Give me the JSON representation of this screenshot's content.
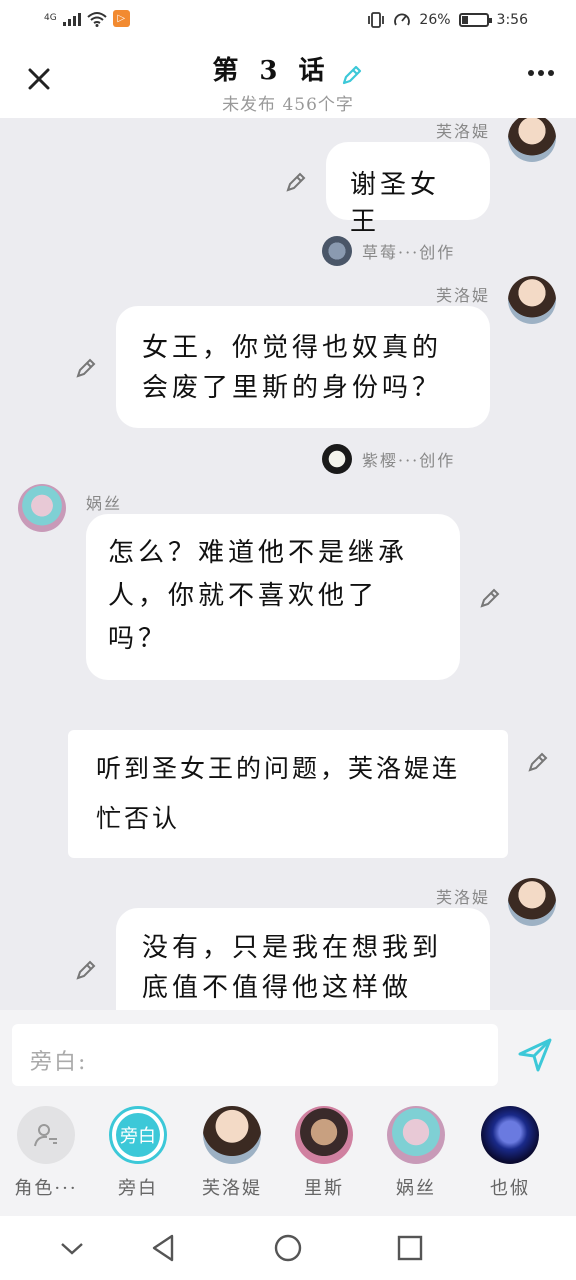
{
  "status_bar": {
    "network": "4G",
    "battery": "26%",
    "battery_level": 0.26,
    "time": "3:56",
    "app_badge_glyph": "▷"
  },
  "header": {
    "title": "第 3 话",
    "subtitle": "未发布  456个字"
  },
  "messages": [
    {
      "speaker": "芙洛媞",
      "text": "谢圣女王"
    },
    {
      "creator": "草莓···创作",
      "speaker": "芙洛媞",
      "line1": "女王，你觉得也奴真的",
      "line2": "会废了里斯的身份吗？"
    },
    {
      "creator": "紫樱···创作",
      "speaker": "娲丝",
      "line1": "怎么？难道他不是继承",
      "line2": "人，你就不喜欢他了",
      "line3": "吗？"
    },
    {
      "type": "narration",
      "line1": "听到圣女王的问题，芙洛媞连",
      "line2": "忙否认"
    },
    {
      "speaker": "芙洛媞",
      "line1": "没有，只是我在想我到",
      "line2": "底值不值得他这样做"
    }
  ],
  "input": {
    "placeholder": "旁白:"
  },
  "roles": [
    {
      "label": "角色···",
      "icon": "add-role-icon"
    },
    {
      "label": "旁白",
      "badge": "旁白"
    },
    {
      "label": "芙洛媞"
    },
    {
      "label": "里斯"
    },
    {
      "label": "娲丝"
    },
    {
      "label": "也俶"
    }
  ],
  "colors": {
    "accent": "#3cc8d8",
    "chat_bg": "#ececf0",
    "app_badge": "#f28a30"
  }
}
